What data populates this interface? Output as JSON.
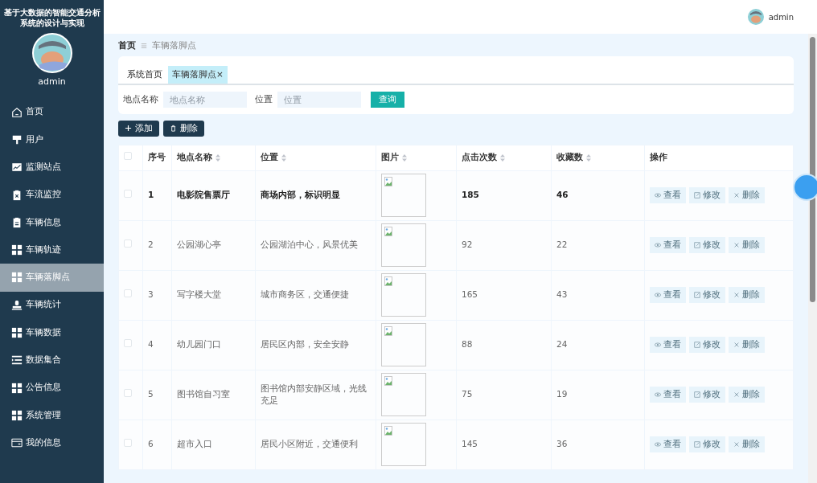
{
  "sidebar": {
    "title": "基于大数据的智能交通分析系统的设计与实现",
    "user": "admin",
    "items": [
      {
        "label": "首页",
        "kind": "home",
        "selected": false
      },
      {
        "label": "用户",
        "kind": "brush",
        "selected": false
      },
      {
        "label": "监测站点",
        "kind": "chart",
        "selected": false
      },
      {
        "label": "车流监控",
        "kind": "clipboard-x",
        "selected": false
      },
      {
        "label": "车辆信息",
        "kind": "clipboard",
        "selected": false
      },
      {
        "label": "车辆轨迹",
        "kind": "grid",
        "selected": false
      },
      {
        "label": "车辆落脚点",
        "kind": "grid",
        "selected": true
      },
      {
        "label": "车辆统计",
        "kind": "stamp",
        "selected": false
      },
      {
        "label": "车辆数据",
        "kind": "grid",
        "selected": false
      },
      {
        "label": "数据集合",
        "kind": "list",
        "selected": false
      },
      {
        "label": "公告信息",
        "kind": "grid",
        "selected": false
      },
      {
        "label": "系统管理",
        "kind": "grid",
        "selected": false
      },
      {
        "label": "我的信息",
        "kind": "card",
        "selected": false
      }
    ]
  },
  "header": {
    "user": "admin"
  },
  "breadcrumb": [
    "首页",
    "车辆落脚点"
  ],
  "tabs": [
    {
      "label": "系统首页",
      "selected": false
    },
    {
      "label": "车辆落脚点",
      "selected": true,
      "close": "×"
    }
  ],
  "search": {
    "fields": [
      {
        "label": "地点名称",
        "placeholder": "地点名称"
      },
      {
        "label": "位置",
        "placeholder": "位置"
      }
    ],
    "button": "查询"
  },
  "actions": [
    {
      "label": "添加",
      "kind": "add"
    },
    {
      "label": "删除",
      "kind": "delete"
    }
  ],
  "table": {
    "all_checked": false,
    "columns": [
      {
        "label": "序号",
        "sortable": false
      },
      {
        "label": "地点名称",
        "sortable": true
      },
      {
        "label": "位置",
        "sortable": true
      },
      {
        "label": "图片",
        "sortable": true
      },
      {
        "label": "点击次数",
        "sortable": true
      },
      {
        "label": "收藏数",
        "sortable": true
      },
      {
        "label": "操作",
        "sortable": false
      }
    ],
    "rows": [
      {
        "index": "1",
        "name": "电影院售票厅",
        "location": "商场内部，标识明显",
        "clicks": "185",
        "favorites": "46",
        "checked": false,
        "selected": true,
        "actions": [
          {
            "label": "查看",
            "kind": "view"
          },
          {
            "label": "修改",
            "kind": "edit"
          },
          {
            "label": "删除",
            "kind": "delete"
          }
        ]
      },
      {
        "index": "2",
        "name": "公园湖心亭",
        "location": "公园湖泊中心，风景优美",
        "clicks": "92",
        "favorites": "22",
        "checked": false,
        "selected": false,
        "actions": [
          {
            "label": "查看",
            "kind": "view"
          },
          {
            "label": "修改",
            "kind": "edit"
          },
          {
            "label": "删除",
            "kind": "delete"
          }
        ]
      },
      {
        "index": "3",
        "name": "写字楼大堂",
        "location": "城市商务区，交通便捷",
        "clicks": "165",
        "favorites": "43",
        "checked": false,
        "selected": false,
        "actions": [
          {
            "label": "查看",
            "kind": "view"
          },
          {
            "label": "修改",
            "kind": "edit"
          },
          {
            "label": "删除",
            "kind": "delete"
          }
        ]
      },
      {
        "index": "4",
        "name": "幼儿园门口",
        "location": "居民区内部，安全安静",
        "clicks": "88",
        "favorites": "24",
        "checked": false,
        "selected": false,
        "actions": [
          {
            "label": "查看",
            "kind": "view"
          },
          {
            "label": "修改",
            "kind": "edit"
          },
          {
            "label": "删除",
            "kind": "delete"
          }
        ]
      },
      {
        "index": "5",
        "name": "图书馆自习室",
        "location": "图书馆内部安静区域，光线充足",
        "clicks": "75",
        "favorites": "19",
        "checked": false,
        "selected": false,
        "actions": [
          {
            "label": "查看",
            "kind": "view"
          },
          {
            "label": "修改",
            "kind": "edit"
          },
          {
            "label": "删除",
            "kind": "delete"
          }
        ]
      },
      {
        "index": "6",
        "name": "超市入口",
        "location": "居民小区附近，交通便利",
        "clicks": "145",
        "favorites": "36",
        "checked": false,
        "selected": false,
        "actions": [
          {
            "label": "查看",
            "kind": "view"
          },
          {
            "label": "修改",
            "kind": "edit"
          },
          {
            "label": "删除",
            "kind": "delete"
          }
        ]
      }
    ]
  }
}
